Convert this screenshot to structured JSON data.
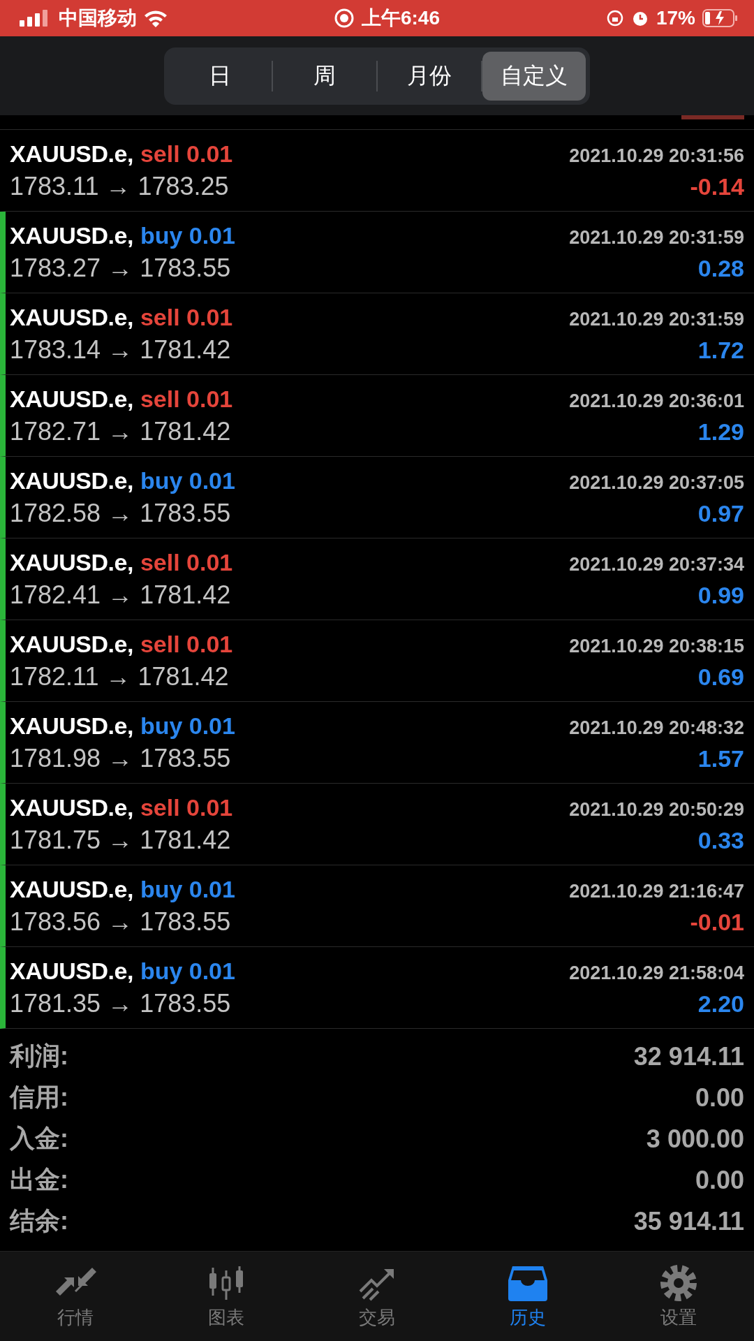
{
  "status_bar": {
    "carrier": "中国移动",
    "time": "上午6:46",
    "battery": "17%"
  },
  "period_tabs": [
    {
      "label": "日",
      "selected": false
    },
    {
      "label": "周",
      "selected": false
    },
    {
      "label": "月份",
      "selected": false
    },
    {
      "label": "自定义",
      "selected": true
    }
  ],
  "deals": [
    {
      "symbol": "XAUUSD.e,",
      "side": "sell",
      "lots": "0.01",
      "time": "2021.10.29 20:31:56",
      "prices": "1783.11 → 1783.25",
      "profit": "-0.14",
      "negative": true,
      "marked": false
    },
    {
      "symbol": "XAUUSD.e,",
      "side": "buy",
      "lots": "0.01",
      "time": "2021.10.29 20:31:59",
      "prices": "1783.27 → 1783.55",
      "profit": "0.28",
      "negative": false,
      "marked": true
    },
    {
      "symbol": "XAUUSD.e,",
      "side": "sell",
      "lots": "0.01",
      "time": "2021.10.29 20:31:59",
      "prices": "1783.14 → 1781.42",
      "profit": "1.72",
      "negative": false,
      "marked": true
    },
    {
      "symbol": "XAUUSD.e,",
      "side": "sell",
      "lots": "0.01",
      "time": "2021.10.29 20:36:01",
      "prices": "1782.71 → 1781.42",
      "profit": "1.29",
      "negative": false,
      "marked": true
    },
    {
      "symbol": "XAUUSD.e,",
      "side": "buy",
      "lots": "0.01",
      "time": "2021.10.29 20:37:05",
      "prices": "1782.58 → 1783.55",
      "profit": "0.97",
      "negative": false,
      "marked": true
    },
    {
      "symbol": "XAUUSD.e,",
      "side": "sell",
      "lots": "0.01",
      "time": "2021.10.29 20:37:34",
      "prices": "1782.41 → 1781.42",
      "profit": "0.99",
      "negative": false,
      "marked": true
    },
    {
      "symbol": "XAUUSD.e,",
      "side": "sell",
      "lots": "0.01",
      "time": "2021.10.29 20:38:15",
      "prices": "1782.11 → 1781.42",
      "profit": "0.69",
      "negative": false,
      "marked": true
    },
    {
      "symbol": "XAUUSD.e,",
      "side": "buy",
      "lots": "0.01",
      "time": "2021.10.29 20:48:32",
      "prices": "1781.98 → 1783.55",
      "profit": "1.57",
      "negative": false,
      "marked": true
    },
    {
      "symbol": "XAUUSD.e,",
      "side": "sell",
      "lots": "0.01",
      "time": "2021.10.29 20:50:29",
      "prices": "1781.75 → 1781.42",
      "profit": "0.33",
      "negative": false,
      "marked": true
    },
    {
      "symbol": "XAUUSD.e,",
      "side": "buy",
      "lots": "0.01",
      "time": "2021.10.29 21:16:47",
      "prices": "1783.56 → 1783.55",
      "profit": "-0.01",
      "negative": true,
      "marked": true
    },
    {
      "symbol": "XAUUSD.e,",
      "side": "buy",
      "lots": "0.01",
      "time": "2021.10.29 21:58:04",
      "prices": "1781.35 → 1783.55",
      "profit": "2.20",
      "negative": false,
      "marked": true
    }
  ],
  "summary": [
    {
      "label": "利润:",
      "value": "32 914.11"
    },
    {
      "label": "信用:",
      "value": "0.00"
    },
    {
      "label": "入金:",
      "value": "3 000.00"
    },
    {
      "label": "出金:",
      "value": "0.00"
    },
    {
      "label": "结余:",
      "value": "35 914.11"
    }
  ],
  "bottom_tabs": [
    {
      "label": "行情",
      "selected": false
    },
    {
      "label": "图表",
      "selected": false
    },
    {
      "label": "交易",
      "selected": false
    },
    {
      "label": "历史",
      "selected": true
    },
    {
      "label": "设置",
      "selected": false
    }
  ]
}
